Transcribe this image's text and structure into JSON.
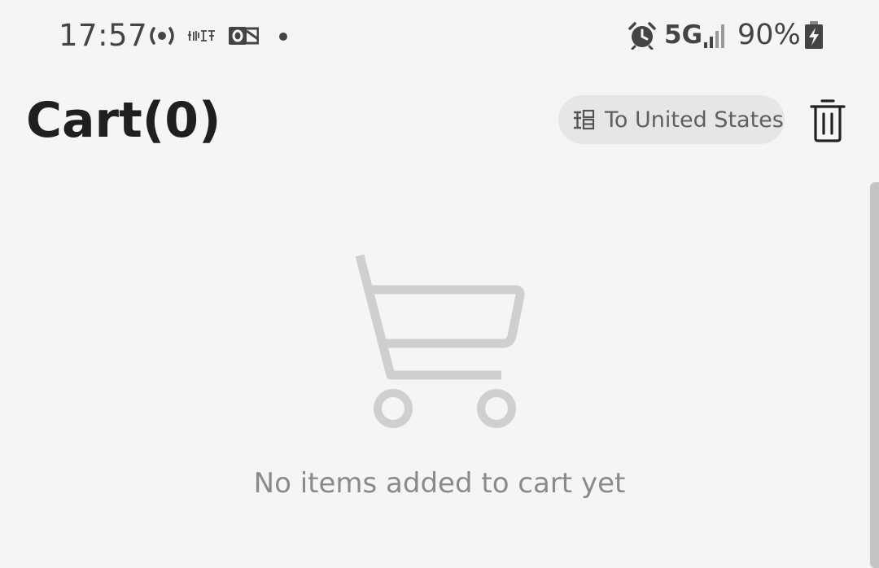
{
  "status_bar": {
    "time": "17:57",
    "network": "5G",
    "battery": "90%",
    "icons": [
      "radio-broadcast-icon",
      "xiaohongshu-app-icon",
      "outlook-icon",
      "notification-dot-icon",
      "alarm-icon",
      "signal-bars-icon",
      "battery-charging-icon"
    ]
  },
  "header": {
    "title": "Cart(0)",
    "ship_to_label": "To United States",
    "ship_to_icon": "ship-to-region-icon",
    "delete_icon": "trash-icon"
  },
  "empty_state": {
    "icon": "shopping-cart-icon",
    "message": "No items added to cart yet"
  },
  "colors": {
    "background": "#f5f5f5",
    "title": "#1f1f1f",
    "pill_background": "#e6e6e6",
    "muted_text": "#8a8a8a",
    "cart_illustration": "#cfcfcf"
  }
}
